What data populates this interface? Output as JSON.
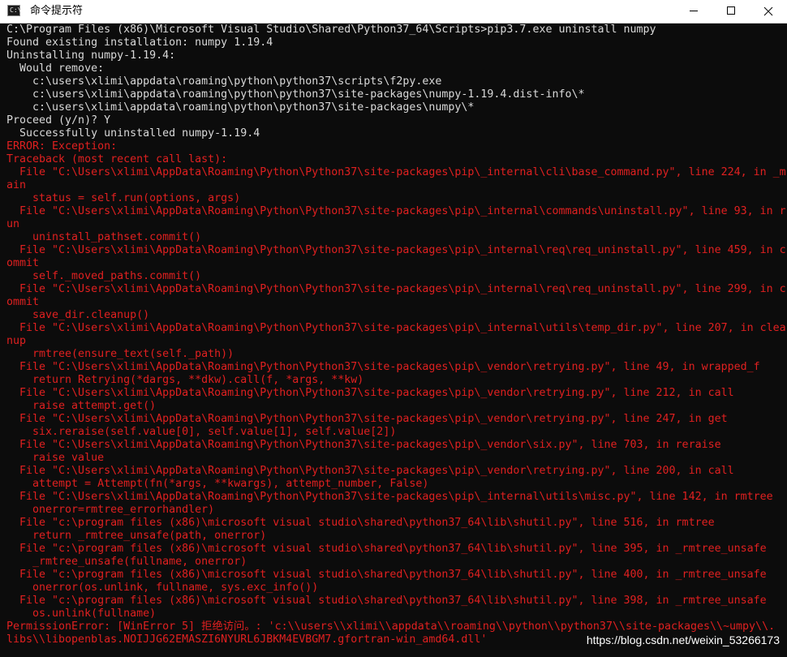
{
  "window": {
    "title": "命令提示符",
    "icon": "cmd-icon",
    "minimize_icon": "minimize-icon",
    "maximize_icon": "maximize-icon",
    "close_icon": "close-icon"
  },
  "colors": {
    "normal_text": "#d9d9d9",
    "error_text": "#e02020",
    "background": "#0c0c0c"
  },
  "console": {
    "lines": [
      {
        "text": "C:\\Program Files (x86)\\Microsoft Visual Studio\\Shared\\Python37_64\\Scripts>pip3.7.exe uninstall numpy",
        "style": "wl"
      },
      {
        "text": "Found existing installation: numpy 1.19.4",
        "style": "wl"
      },
      {
        "text": "Uninstalling numpy-1.19.4:",
        "style": "wl"
      },
      {
        "text": "  Would remove:",
        "style": "wl"
      },
      {
        "text": "    c:\\users\\xlimi\\appdata\\roaming\\python\\python37\\scripts\\f2py.exe",
        "style": "wl"
      },
      {
        "text": "    c:\\users\\xlimi\\appdata\\roaming\\python\\python37\\site-packages\\numpy-1.19.4.dist-info\\*",
        "style": "wl"
      },
      {
        "text": "    c:\\users\\xlimi\\appdata\\roaming\\python\\python37\\site-packages\\numpy\\*",
        "style": "wl"
      },
      {
        "text": "Proceed (y/n)? Y",
        "style": "wl"
      },
      {
        "text": "  Successfully uninstalled numpy-1.19.4",
        "style": "wl"
      },
      {
        "text": "ERROR: Exception:",
        "style": "rd"
      },
      {
        "text": "Traceback (most recent call last):",
        "style": "rd"
      },
      {
        "text": "  File \"C:\\Users\\xlimi\\AppData\\Roaming\\Python\\Python37\\site-packages\\pip\\_internal\\cli\\base_command.py\", line 224, in _m",
        "style": "rd"
      },
      {
        "text": "ain",
        "style": "rd"
      },
      {
        "text": "    status = self.run(options, args)",
        "style": "rd"
      },
      {
        "text": "  File \"C:\\Users\\xlimi\\AppData\\Roaming\\Python\\Python37\\site-packages\\pip\\_internal\\commands\\uninstall.py\", line 93, in r",
        "style": "rd"
      },
      {
        "text": "un",
        "style": "rd"
      },
      {
        "text": "    uninstall_pathset.commit()",
        "style": "rd"
      },
      {
        "text": "  File \"C:\\Users\\xlimi\\AppData\\Roaming\\Python\\Python37\\site-packages\\pip\\_internal\\req\\req_uninstall.py\", line 459, in c",
        "style": "rd"
      },
      {
        "text": "ommit",
        "style": "rd"
      },
      {
        "text": "    self._moved_paths.commit()",
        "style": "rd"
      },
      {
        "text": "  File \"C:\\Users\\xlimi\\AppData\\Roaming\\Python\\Python37\\site-packages\\pip\\_internal\\req\\req_uninstall.py\", line 299, in c",
        "style": "rd"
      },
      {
        "text": "ommit",
        "style": "rd"
      },
      {
        "text": "    save_dir.cleanup()",
        "style": "rd"
      },
      {
        "text": "  File \"C:\\Users\\xlimi\\AppData\\Roaming\\Python\\Python37\\site-packages\\pip\\_internal\\utils\\temp_dir.py\", line 207, in clea",
        "style": "rd"
      },
      {
        "text": "nup",
        "style": "rd"
      },
      {
        "text": "    rmtree(ensure_text(self._path))",
        "style": "rd"
      },
      {
        "text": "  File \"C:\\Users\\xlimi\\AppData\\Roaming\\Python\\Python37\\site-packages\\pip\\_vendor\\retrying.py\", line 49, in wrapped_f",
        "style": "rd"
      },
      {
        "text": "    return Retrying(*dargs, **dkw).call(f, *args, **kw)",
        "style": "rd"
      },
      {
        "text": "  File \"C:\\Users\\xlimi\\AppData\\Roaming\\Python\\Python37\\site-packages\\pip\\_vendor\\retrying.py\", line 212, in call",
        "style": "rd"
      },
      {
        "text": "    raise attempt.get()",
        "style": "rd"
      },
      {
        "text": "  File \"C:\\Users\\xlimi\\AppData\\Roaming\\Python\\Python37\\site-packages\\pip\\_vendor\\retrying.py\", line 247, in get",
        "style": "rd"
      },
      {
        "text": "    six.reraise(self.value[0], self.value[1], self.value[2])",
        "style": "rd"
      },
      {
        "text": "  File \"C:\\Users\\xlimi\\AppData\\Roaming\\Python\\Python37\\site-packages\\pip\\_vendor\\six.py\", line 703, in reraise",
        "style": "rd"
      },
      {
        "text": "    raise value",
        "style": "rd"
      },
      {
        "text": "  File \"C:\\Users\\xlimi\\AppData\\Roaming\\Python\\Python37\\site-packages\\pip\\_vendor\\retrying.py\", line 200, in call",
        "style": "rd"
      },
      {
        "text": "    attempt = Attempt(fn(*args, **kwargs), attempt_number, False)",
        "style": "rd"
      },
      {
        "text": "  File \"C:\\Users\\xlimi\\AppData\\Roaming\\Python\\Python37\\site-packages\\pip\\_internal\\utils\\misc.py\", line 142, in rmtree",
        "style": "rd"
      },
      {
        "text": "    onerror=rmtree_errorhandler)",
        "style": "rd"
      },
      {
        "text": "  File \"c:\\program files (x86)\\microsoft visual studio\\shared\\python37_64\\lib\\shutil.py\", line 516, in rmtree",
        "style": "rd"
      },
      {
        "text": "    return _rmtree_unsafe(path, onerror)",
        "style": "rd"
      },
      {
        "text": "  File \"c:\\program files (x86)\\microsoft visual studio\\shared\\python37_64\\lib\\shutil.py\", line 395, in _rmtree_unsafe",
        "style": "rd"
      },
      {
        "text": "    _rmtree_unsafe(fullname, onerror)",
        "style": "rd"
      },
      {
        "text": "  File \"c:\\program files (x86)\\microsoft visual studio\\shared\\python37_64\\lib\\shutil.py\", line 400, in _rmtree_unsafe",
        "style": "rd"
      },
      {
        "text": "    onerror(os.unlink, fullname, sys.exc_info())",
        "style": "rd"
      },
      {
        "text": "  File \"c:\\program files (x86)\\microsoft visual studio\\shared\\python37_64\\lib\\shutil.py\", line 398, in _rmtree_unsafe",
        "style": "rd"
      },
      {
        "text": "    os.unlink(fullname)",
        "style": "rd"
      },
      {
        "text": "PermissionError: [WinError 5] 拒绝访问。: 'c:\\\\users\\\\xlimi\\\\appdata\\\\roaming\\\\python\\\\python37\\\\site-packages\\\\~umpy\\\\.",
        "style": "rd"
      },
      {
        "text": "libs\\\\libopenblas.NOIJJG62EMASZI6NYURL6JBKM4EVBGM7.gfortran-win_amd64.dll'",
        "style": "rd"
      }
    ]
  },
  "watermark": "https://blog.csdn.net/weixin_53266173"
}
